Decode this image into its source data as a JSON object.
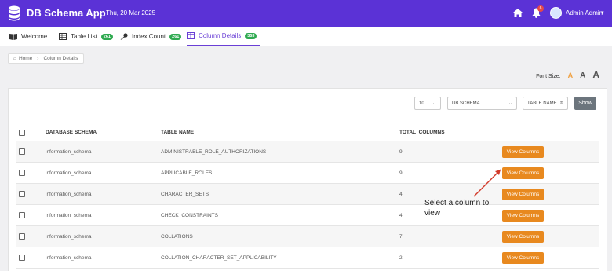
{
  "header": {
    "app_title": "DB Schema App",
    "date": "Thu, 20 Mar 2025",
    "notification_count": "6",
    "user_name": "Admin Admin"
  },
  "tabs": [
    {
      "label": "Welcome",
      "icon": "book-icon"
    },
    {
      "label": "Table List",
      "icon": "table-icon",
      "badge": "261"
    },
    {
      "label": "Index Count",
      "icon": "key-icon",
      "badge": "261"
    },
    {
      "label": "Column Details",
      "icon": "columns-icon",
      "badge": "353",
      "active": true
    }
  ],
  "breadcrumb": {
    "home": "Home",
    "current": "Column Details"
  },
  "font_size": {
    "label": "Font Size:",
    "small": "A",
    "medium": "A",
    "large": "A"
  },
  "controls": {
    "page_length": "10",
    "schema_select": "DB SCHEMA",
    "table_select": "TABLE NAME",
    "show_label": "Show"
  },
  "table": {
    "headers": [
      "DATABASE SCHEMA",
      "TABLE NAME",
      "TOTAL_COLUMNS"
    ],
    "rows": [
      {
        "schema": "information_schema",
        "table": "ADMINISTRABLE_ROLE_AUTHORIZATIONS",
        "total": "9",
        "action": "View Columns"
      },
      {
        "schema": "information_schema",
        "table": "APPLICABLE_ROLES",
        "total": "9",
        "action": "View Columns"
      },
      {
        "schema": "information_schema",
        "table": "CHARACTER_SETS",
        "total": "4",
        "action": "View Columns"
      },
      {
        "schema": "information_schema",
        "table": "CHECK_CONSTRAINTS",
        "total": "4",
        "action": "View Columns"
      },
      {
        "schema": "information_schema",
        "table": "COLLATIONS",
        "total": "7",
        "action": "View Columns"
      },
      {
        "schema": "information_schema",
        "table": "COLLATION_CHARACTER_SET_APPLICABILITY",
        "total": "2",
        "action": "View Columns"
      }
    ]
  },
  "annotation": {
    "text": "Select a column to view"
  },
  "colors": {
    "header_bg": "#5b32d6",
    "accent": "#6a3fd6",
    "badge": "#2faa50",
    "action_button": "#e8891f",
    "show_button": "#6c757d"
  }
}
